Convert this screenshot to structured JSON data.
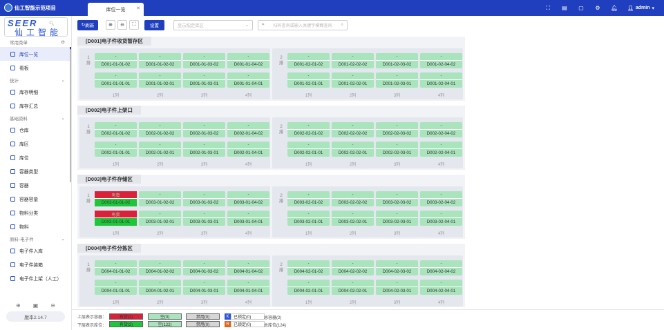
{
  "app": {
    "title": "仙工智能示范项目",
    "brand_top": "SEER",
    "brand_cn": "仙工智能"
  },
  "tab": {
    "label": "库位一览"
  },
  "user": {
    "name": "admin"
  },
  "sidebar": {
    "sections": [
      {
        "label": "常用菜单",
        "items": [
          {
            "label": "库位一览",
            "active": true
          },
          {
            "label": "看板"
          }
        ]
      },
      {
        "label": "统计",
        "items": [
          {
            "label": "库存明细"
          },
          {
            "label": "库存汇总"
          }
        ]
      },
      {
        "label": "基础资料",
        "items": [
          {
            "label": "仓库"
          },
          {
            "label": "库区"
          },
          {
            "label": "库位"
          },
          {
            "label": "容器类型"
          },
          {
            "label": "容器"
          },
          {
            "label": "容器容量"
          },
          {
            "label": "物料分类"
          },
          {
            "label": "物料"
          }
        ]
      },
      {
        "label": "原料-电子件",
        "items": [
          {
            "label": "电子件入库"
          },
          {
            "label": "电子件装箱"
          },
          {
            "label": "电子件上架（人工）"
          }
        ]
      }
    ],
    "version": "版本2.14.7"
  },
  "toolbar": {
    "refresh": "刷新",
    "settings": "设置",
    "select_placeholder": "显示指定库区",
    "search_placeholder": "扫码查询或输入关键字模糊查询"
  },
  "areas": [
    {
      "title": "[D001]电子件收货暂存区",
      "code": "D001",
      "full": []
    },
    {
      "title": "[D002]电子件上架口",
      "code": "D002",
      "full": []
    },
    {
      "title": "[D003]电子件存储区",
      "code": "D003",
      "full": [
        "D003-01-01-02",
        "D003-01-01-01"
      ]
    },
    {
      "title": "[D004]电子件分拣区",
      "code": "D004",
      "full": []
    }
  ],
  "area_labels": {
    "rows": [
      "1排",
      "2排"
    ],
    "columns": [
      "1列",
      "2列",
      "3列",
      "4列"
    ],
    "empty_value": "-",
    "full_value": "有货"
  },
  "legend": {
    "upper_label": "上层表示容器：",
    "lower_label": "下层表示库位：",
    "upper_full": "有货(2)",
    "upper_empty": "空(0)",
    "upper_disabled": "禁用(0)",
    "lower_full": "有货(2)",
    "lower_empty": "空(122)",
    "lower_disabled": "禁用(0)",
    "locked_in": "已锁定(0)",
    "locked_out": "已锁定(0)",
    "container_total": "总容器(2)",
    "location_total": "总库位(124)",
    "colors": {
      "full_upper": "#d9213a",
      "full_lower": "#1fc53a",
      "empty": "#a9e4bc",
      "disabled": "#d6d6d6",
      "badge_blue": "#2c55d8",
      "badge_orange": "#e0641c"
    }
  }
}
